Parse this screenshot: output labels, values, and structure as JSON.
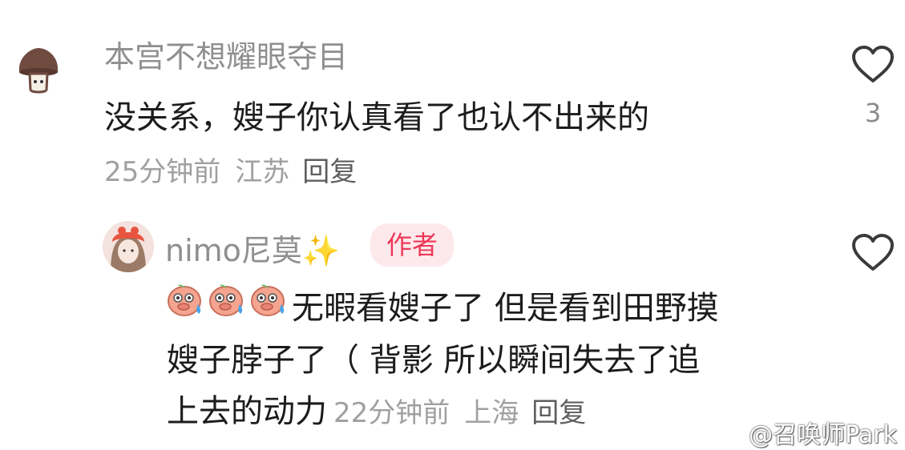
{
  "comments": [
    {
      "username": "本宫不想耀眼夺目",
      "text": "没关系，嫂子你认真看了也认不出来的",
      "time": "25分钟前",
      "location": "江苏",
      "reply_label": "回复",
      "like_count": "3",
      "avatar_icon": "mushroom-avatar"
    },
    {
      "username": "nimo尼莫",
      "sparkle": "✨",
      "author_badge": "作者",
      "text_line1": "无暇看嫂子了 但是看到田野摸",
      "text_line2": "嫂子脖子了（ 背影 所以瞬间失去了追",
      "text_line3": "上去的动力",
      "time": "22分钟前",
      "location": "上海",
      "reply_label": "回复",
      "emoji_icon": "sweating-pig-face-emoji",
      "avatar_icon": "girl-avatar"
    }
  ],
  "watermark": "@召唤师Park",
  "colors": {
    "accent": "#ee3858",
    "badge_bg": "#fde9ec",
    "muted": "#a0a0a0",
    "text": "#1c1c1c"
  }
}
